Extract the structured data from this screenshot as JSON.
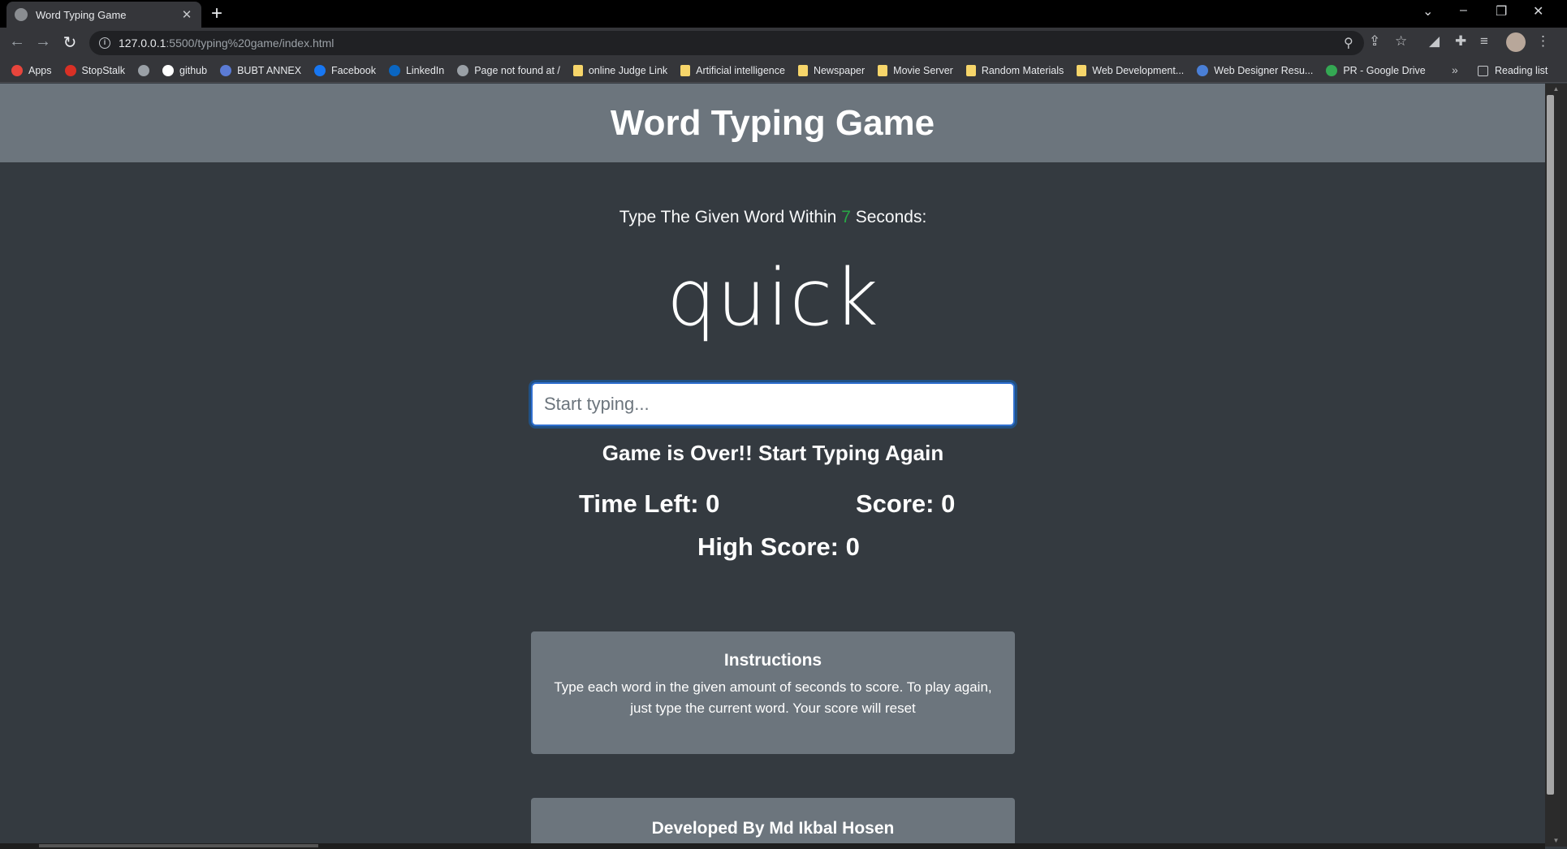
{
  "browser": {
    "tab_title": "Word Typing Game",
    "tab_close": "✕",
    "new_tab": "+",
    "url_host": "127.0.0.1",
    "url_path": ":5500/typing%20game/index.html",
    "window_controls": {
      "tabsearch": "⌄",
      "minimize": "–",
      "restore": "❐",
      "close": "✕"
    },
    "bookmarks": [
      {
        "label": "Apps",
        "icon": "apps-grid-icon",
        "color": "#e8453c"
      },
      {
        "label": "StopStalk",
        "icon": "stopstalk-icon",
        "color": "#d93025"
      },
      {
        "label": "",
        "icon": "globe-icon",
        "color": "#9aa0a6"
      },
      {
        "label": "github",
        "icon": "github-icon",
        "color": "#ffffff"
      },
      {
        "label": "BUBT ANNEX",
        "icon": "bubt-icon",
        "color": "#5b7bd5"
      },
      {
        "label": "Facebook",
        "icon": "facebook-icon",
        "color": "#1877f2"
      },
      {
        "label": "LinkedIn",
        "icon": "linkedin-icon",
        "color": "#0a66c2"
      },
      {
        "label": "Page not found at /",
        "icon": "globe-icon",
        "color": "#9aa0a6"
      },
      {
        "label": "online Judge Link",
        "icon": "folder-icon",
        "color": "#f6d56a"
      },
      {
        "label": "Artificial intelligence",
        "icon": "folder-icon",
        "color": "#f6d56a"
      },
      {
        "label": "Newspaper",
        "icon": "folder-icon",
        "color": "#f6d56a"
      },
      {
        "label": "Movie Server",
        "icon": "folder-icon",
        "color": "#f6d56a"
      },
      {
        "label": "Random Materials",
        "icon": "folder-icon",
        "color": "#f6d56a"
      },
      {
        "label": "Web Development...",
        "icon": "folder-icon",
        "color": "#f6d56a"
      },
      {
        "label": "Web Designer Resu...",
        "icon": "web-designer-icon",
        "color": "#4a7fd6"
      },
      {
        "label": "PR - Google Drive",
        "icon": "google-drive-icon",
        "color": "#34a853"
      }
    ],
    "bookmarks_more": "»",
    "reading_list": "Reading list"
  },
  "game": {
    "title": "Word Typing Game",
    "lead_prefix": "Type The Given Word Within ",
    "seconds": "7",
    "lead_suffix": " Seconds:",
    "current_word": "quick",
    "input_placeholder": "Start typing...",
    "message": "Game is Over!! Start Typing Again",
    "time_left_label": "Time Left: ",
    "time_left": "0",
    "score_label": "Score: ",
    "score": "0",
    "high_score_label": "High Score: ",
    "high_score": "0",
    "instructions_title": "Instructions",
    "instructions_text": "Type each word in the given amount of seconds to score. To play again, just type the current word. Your score will reset",
    "footer_text": "Developed By Md Ikbal Hosen"
  },
  "colors": {
    "header_bg": "#6c757d",
    "body_bg": "#343a40",
    "seconds_accent": "#28a745",
    "input_focus": "#2f6fcf"
  }
}
